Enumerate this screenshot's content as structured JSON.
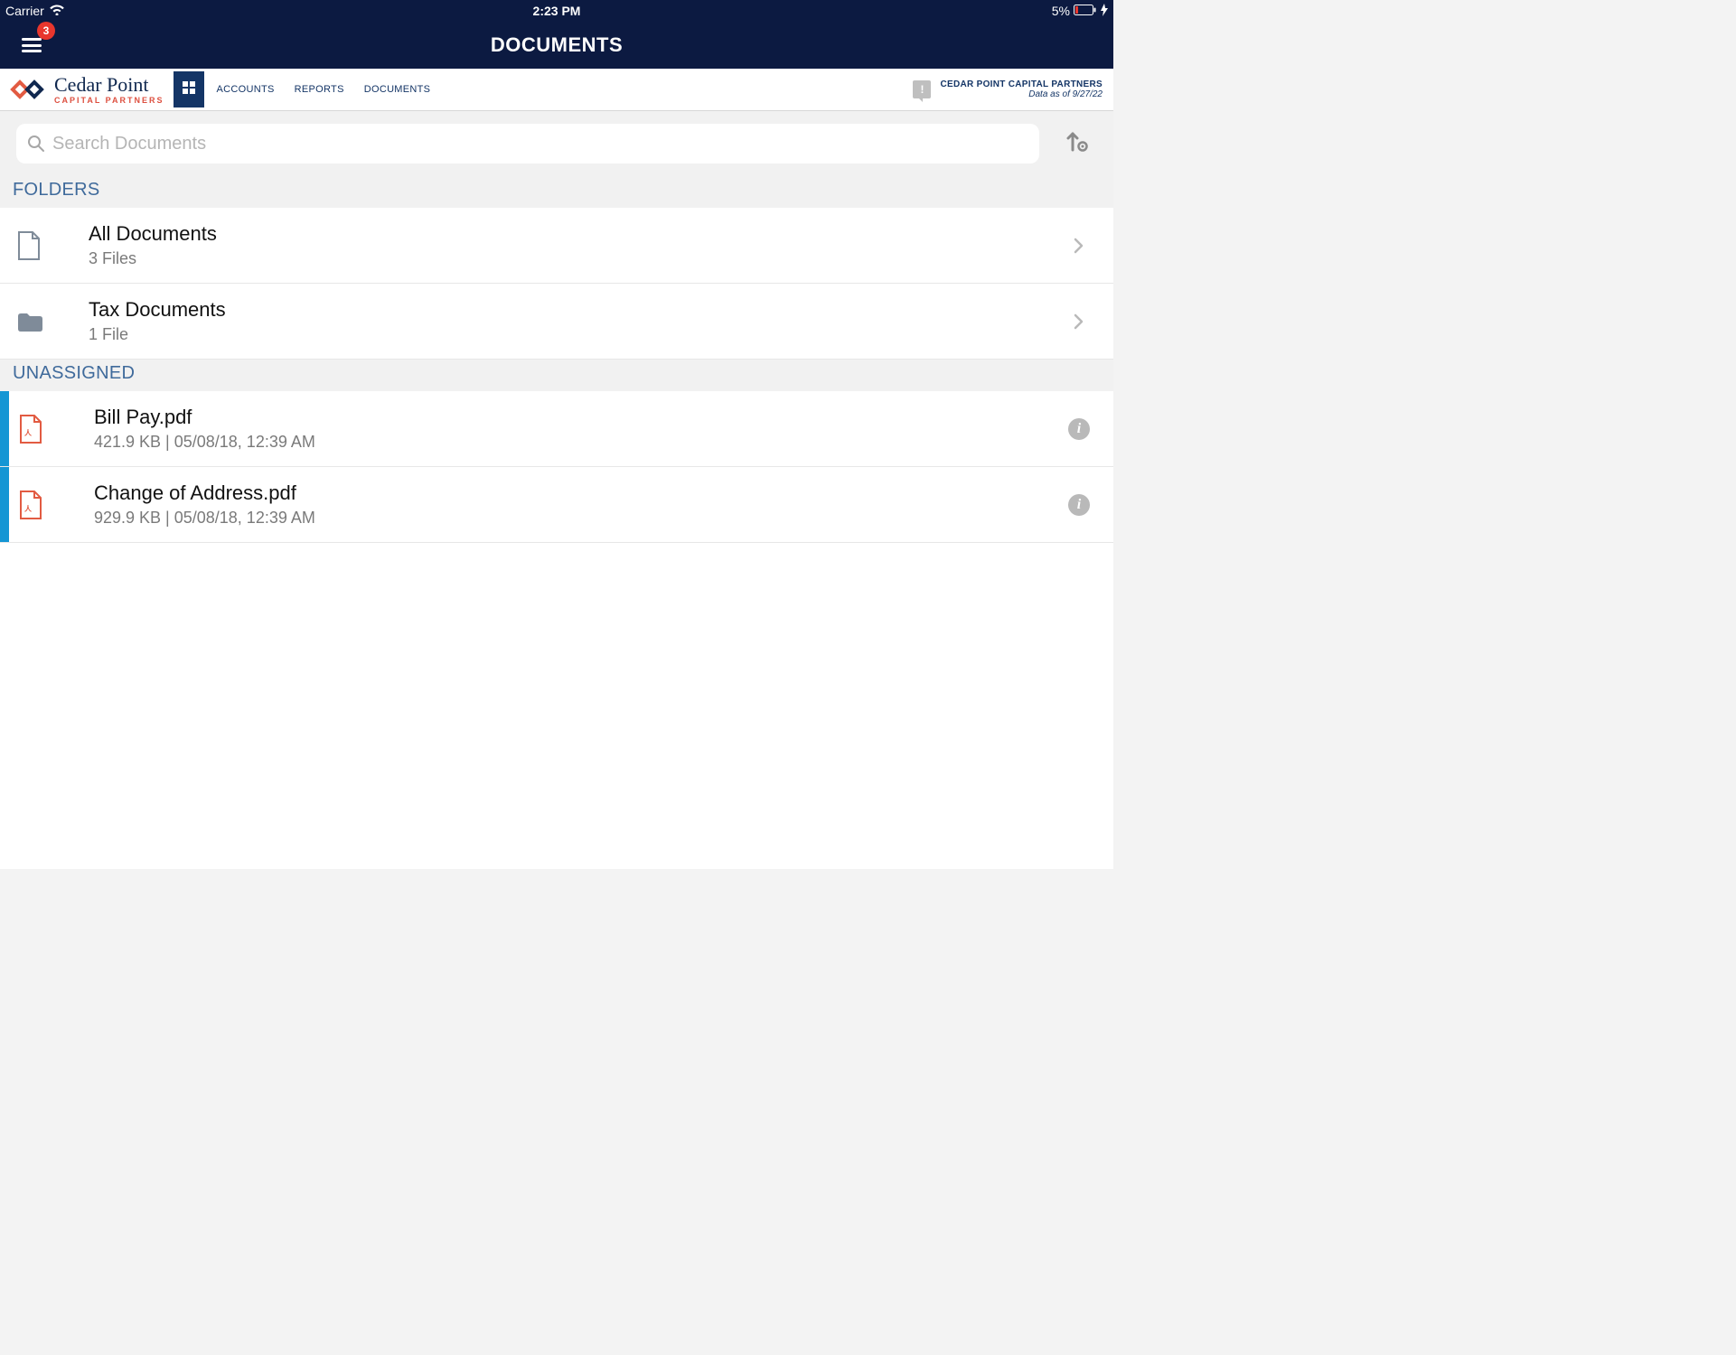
{
  "status_bar": {
    "carrier": "Carrier",
    "time": "2:23 PM",
    "battery_pct": "5%"
  },
  "header": {
    "title": "DOCUMENTS",
    "notif_count": "3"
  },
  "brand": {
    "name_line1": "Cedar Point",
    "name_line2": "CAPITAL PARTNERS"
  },
  "nav": {
    "tabs": [
      "ACCOUNTS",
      "REPORTS",
      "DOCUMENTS"
    ],
    "org_name": "CEDAR POINT CAPITAL PARTNERS",
    "data_as_of": "Data as of 9/27/22",
    "alert_glyph": "!"
  },
  "search": {
    "placeholder": "Search Documents"
  },
  "sections": {
    "folders_label": "FOLDERS",
    "unassigned_label": "UNASSIGNED"
  },
  "folders": [
    {
      "title": "All Documents",
      "subtitle": "3 Files",
      "icon": "document"
    },
    {
      "title": "Tax Documents",
      "subtitle": "1 File",
      "icon": "folder"
    }
  ],
  "files": [
    {
      "title": "Bill Pay.pdf",
      "subtitle": "421.9 KB | 05/08/18, 12:39 AM"
    },
    {
      "title": "Change of Address.pdf",
      "subtitle": "929.9 KB | 05/08/18, 12:39 AM"
    }
  ],
  "info_glyph": "i"
}
